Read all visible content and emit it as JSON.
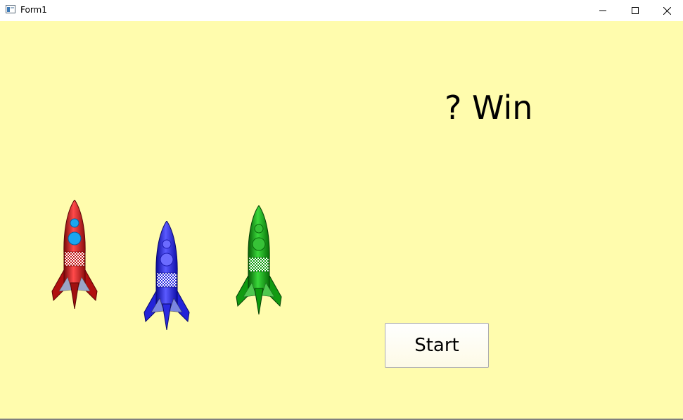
{
  "window": {
    "title": "Form1"
  },
  "titlebar_buttons": [
    "minimize-icon",
    "maximize-icon",
    "close-icon"
  ],
  "main": {
    "result_label": "? Win",
    "start_label": "Start"
  },
  "rockets": [
    {
      "name": "red-rocket",
      "color": "#d41a1a"
    },
    {
      "name": "blue-rocket",
      "color": "#2b2bf2"
    },
    {
      "name": "green-rocket",
      "color": "#12a512"
    }
  ],
  "colors": {
    "background": "#fffcad"
  }
}
